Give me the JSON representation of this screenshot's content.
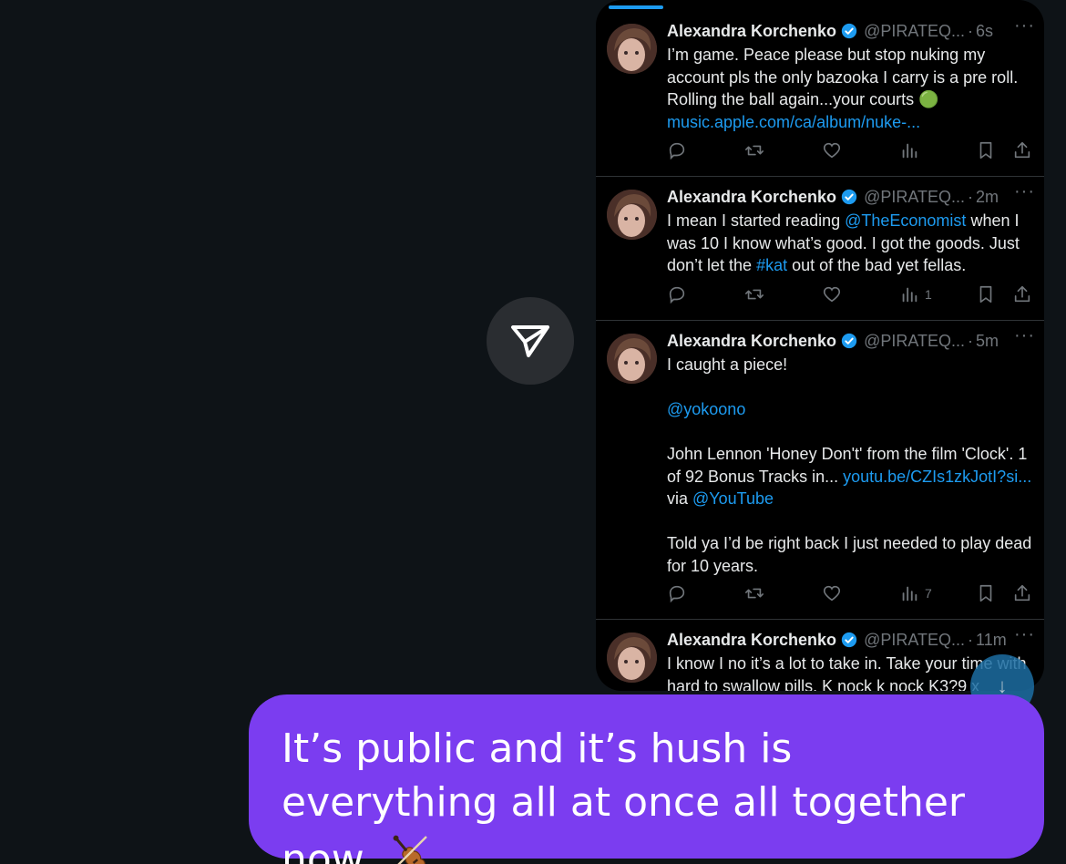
{
  "forward_button": {
    "icon": "send-icon"
  },
  "tweets": [
    {
      "name": "Alexandra Korchenko",
      "handle": "@PIRATEQ...",
      "time": "6s",
      "body": [
        {
          "t": "I’m game. Peace please but stop nuking my account pls the only bazooka I carry is a pre roll. Rolling the ball again...your courts 🟢"
        },
        {
          "t": "music.apple.com/ca/album/nuke-...",
          "link": true
        }
      ],
      "views": ""
    },
    {
      "name": "Alexandra Korchenko",
      "handle": "@PIRATEQ...",
      "time": "2m",
      "body_parts": {
        "p1": "I mean I started reading ",
        "mention": "@TheEconomist",
        "p2": " when I was 10 I know what’s good. I got the goods. Just don’t let the ",
        "hashtag": "#kat",
        "p3": " out of the bad yet fellas."
      },
      "views": "1"
    },
    {
      "name": "Alexandra Korchenko",
      "handle": "@PIRATEQ...",
      "time": "5m",
      "line1": "I caught a piece!",
      "mention": "@yokoono",
      "para_a": "John Lennon 'Honey Don't' from the film 'Clock'. 1 of 92 Bonus Tracks in... ",
      "link": "youtu.be/CZIs1zkJotI?si...",
      "via": " via ",
      "via_mention": "@YouTube",
      "para_b": "Told ya I’d be right back I just needed to play dead for 10 years.",
      "views": "7"
    },
    {
      "name": "Alexandra Korchenko",
      "handle": "@PIRATEQ...",
      "time": "11m",
      "body": "I know I no it’s a lot to take in. Take your time with hard to swallow pills. K nock k nock K3?9 x"
    }
  ],
  "message": {
    "text": "It’s public and it’s hush is everything all at once all together now",
    "emoji": "violin"
  },
  "colors": {
    "background": "#0e1317",
    "card": "#000000",
    "bubble": "#7b3df0",
    "link": "#1d9bf0",
    "text": "#e7e9ea",
    "muted": "#71767b"
  }
}
